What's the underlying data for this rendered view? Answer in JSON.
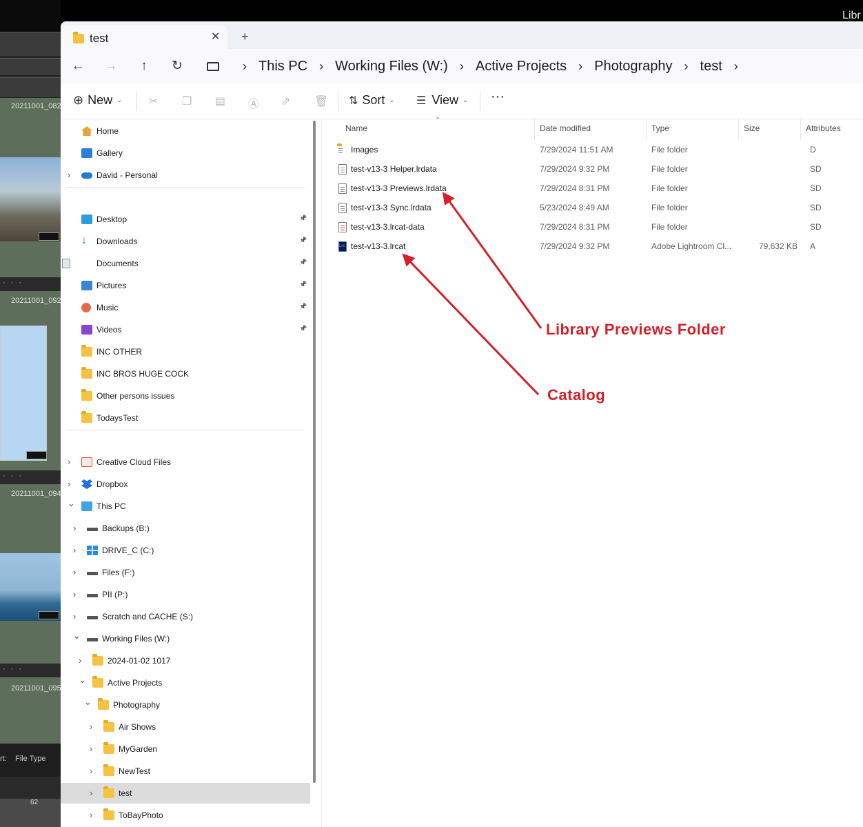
{
  "window": {
    "tab_title": "test",
    "tab_close": "✕",
    "tab_plus": "+"
  },
  "address": {
    "back": "←",
    "forward": "→",
    "up": "↑",
    "refresh": "↻",
    "crumbs": [
      "This PC",
      "Working Files (W:)",
      "Active Projects",
      "Photography",
      "test"
    ]
  },
  "toolbar": {
    "new_label": "New",
    "sort_label": "Sort",
    "view_label": "View",
    "more_label": "···"
  },
  "sidebar": {
    "quick": [
      {
        "label": "Home"
      },
      {
        "label": "Gallery"
      },
      {
        "label": "David - Personal"
      }
    ],
    "pinned": [
      {
        "label": "Desktop"
      },
      {
        "label": "Downloads"
      },
      {
        "label": "Documents"
      },
      {
        "label": "Pictures"
      },
      {
        "label": "Music"
      },
      {
        "label": "Videos"
      },
      {
        "label": "INC OTHER"
      },
      {
        "label": "INC BROS HUGE COCK"
      },
      {
        "label": "Other persons issues"
      },
      {
        "label": "TodaysTest"
      }
    ],
    "locations": [
      {
        "label": "Creative Cloud Files"
      },
      {
        "label": "Dropbox"
      },
      {
        "label": "This PC"
      },
      {
        "label": "Backups (B:)"
      },
      {
        "label": "DRIVE_C (C:)"
      },
      {
        "label": "Files (F:)"
      },
      {
        "label": "PII (P:)"
      },
      {
        "label": "Scratch and CACHE (S:)"
      },
      {
        "label": "Working Files (W:)"
      },
      {
        "label": "2024-01-02 1017"
      },
      {
        "label": "Active Projects"
      },
      {
        "label": "Photography"
      },
      {
        "label": "Air Shows"
      },
      {
        "label": "MyGarden"
      },
      {
        "label": "NewTest"
      },
      {
        "label": "test"
      },
      {
        "label": "ToBayPhoto"
      }
    ]
  },
  "columns": {
    "name": "Name",
    "date": "Date modified",
    "type": "Type",
    "size": "Size",
    "attributes": "Attributes"
  },
  "files": [
    {
      "name": "Images",
      "date": "7/29/2024 11:51 AM",
      "type": "File folder",
      "size": "",
      "attr": "D",
      "icon": "folder-icon"
    },
    {
      "name": "test-v13-3 Helper.lrdata",
      "date": "7/29/2024 9:32 PM",
      "type": "File folder",
      "size": "",
      "attr": "SD",
      "icon": "file-icon"
    },
    {
      "name": "test-v13-3 Previews.lrdata",
      "date": "7/29/2024 8:31 PM",
      "type": "File folder",
      "size": "",
      "attr": "SD",
      "icon": "file-icon"
    },
    {
      "name": "test-v13-3 Sync.lrdata",
      "date": "5/23/2024 8:49 AM",
      "type": "File folder",
      "size": "",
      "attr": "SD",
      "icon": "file-icon"
    },
    {
      "name": "test-v13-3.lrcat-data",
      "date": "7/29/2024 8:31 PM",
      "type": "File folder",
      "size": "",
      "attr": "SD",
      "icon": "file-icon"
    },
    {
      "name": "test-v13-3.lrcat",
      "date": "7/29/2024 9:32 PM",
      "type": "Adobe Lightroom Cl...",
      "size": "79,632 KB",
      "attr": "A",
      "icon": "lrcat-icon"
    }
  ],
  "annotations": {
    "previews": "Library Previews Folder",
    "catalog": "Catalog",
    "color": "#d32029"
  },
  "background_app": {
    "labels": [
      "20211001_082",
      "20211001_092",
      "20211001_094",
      "20211001_095"
    ],
    "sort_text": "rt:",
    "sort_value": "File Type",
    "top_right": "Libr",
    "strip_num": "62"
  }
}
